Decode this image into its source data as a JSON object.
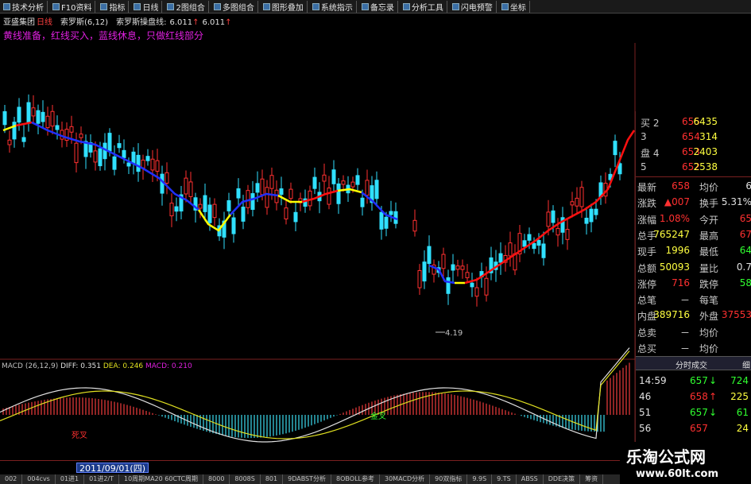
{
  "toolbar": {
    "items": [
      "技术分析",
      "F10资料",
      "指标",
      "日线",
      "2图组合",
      "多图组合",
      "图形叠加",
      "系统指示",
      "备忘录",
      "分析工具",
      "闪电预警",
      "坐标"
    ]
  },
  "info": {
    "stock_name": "亚盛集团",
    "period": "日线",
    "indicator_name": "索罗斯(6,12)",
    "indicator2_name": "索罗斯操盘线:",
    "value1": "6.011",
    "value2": "6.011",
    "description": "黄线准备，红线买入，蓝线休息，只做红线部分"
  },
  "chart": {
    "low_label": "4.19",
    "golden_cross_label": "死叉",
    "green_label": "金叉"
  },
  "macd": {
    "label": "MACD (26,12,9)",
    "diff_label": "DIFF: 0.351",
    "dea_label": "DEA: 0.246",
    "macd_label": "MACD: 0.210"
  },
  "quote": {
    "orders": [
      {
        "label": "买 2",
        "price": "655",
        "vol": "6435"
      },
      {
        "label": "3",
        "price": "654",
        "vol": "314"
      },
      {
        "label": "盘 4",
        "price": "653",
        "vol": "2403"
      },
      {
        "label": "5",
        "price": "652",
        "vol": "2538"
      }
    ],
    "rows": [
      {
        "l1": "最新",
        "v1": "658",
        "l2": "均价",
        "v2": "6"
      },
      {
        "l1": "涨跌",
        "v1": "▲007",
        "l2": "换手",
        "v2": "5.31%"
      },
      {
        "l1": "涨幅",
        "v1": "1.08%",
        "l2": "今开",
        "v2": "65"
      },
      {
        "l1": "总手",
        "v1": "765247",
        "l2": "最高",
        "v2": "67"
      },
      {
        "l1": "现手",
        "v1": "1996",
        "l2": "最低",
        "v2": "64"
      },
      {
        "l1": "总额",
        "v1": "50093",
        "l2": "量比",
        "v2": "0.7"
      },
      {
        "l1": "涨停",
        "v1": "716",
        "l2": "跌停",
        "v2": "58"
      },
      {
        "l1": "总笔",
        "v1": "－",
        "l2": "每笔",
        "v2": ""
      },
      {
        "l1": "内盘",
        "v1": "389716",
        "l2": "外盘",
        "v2": "37553"
      },
      {
        "l1": "总卖",
        "v1": "－",
        "l2": "均价",
        "v2": ""
      },
      {
        "l1": "总买",
        "v1": "－",
        "l2": "均价",
        "v2": ""
      }
    ],
    "trade_header": "分时成交",
    "trade_header_right": "细",
    "trades": [
      {
        "time": "14:59",
        "price": "657",
        "arrow": "↓",
        "vol": "724"
      },
      {
        "time": "46",
        "price": "658",
        "arrow": "↑",
        "vol": "225"
      },
      {
        "time": "51",
        "price": "657",
        "arrow": "↓",
        "vol": "61"
      },
      {
        "time": "56",
        "price": "657",
        "arrow": "",
        "vol": "24"
      }
    ]
  },
  "bottom": {
    "date": "2011/09/01(四)",
    "tabs": [
      "002",
      "004cvs",
      "01进1",
      "01进2/T",
      "10周期MA20 60CTC周期",
      "8000",
      "8008S",
      "801",
      "9DABST分析",
      "8OBOLL参考",
      "30MACD分析",
      "90双指标",
      "9.9S",
      "9.TS",
      "ABSS",
      "DDE决策",
      "筹资"
    ]
  },
  "watermark": {
    "title": "乐淘公式网",
    "url": "www.60lt.com"
  },
  "colors": {
    "up": "#ff3030",
    "down": "#30e0ff",
    "red_line": "#ff1010",
    "blue_line": "#2030ff",
    "yellow_line": "#ffff00"
  }
}
